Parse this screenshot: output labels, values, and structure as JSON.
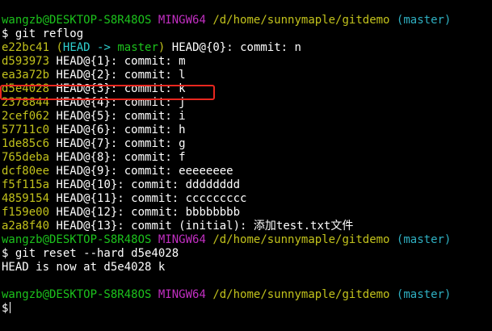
{
  "prompt": {
    "user_host": "wangzb@DESKTOP-S8R48OS",
    "system": "MINGW64",
    "path": "/d/home/sunnymaple/gitdemo",
    "branch": "(master)"
  },
  "commands": {
    "reflog": "$ git reflog",
    "reset": "$ git reset --hard d5e4028",
    "final_prompt": "$"
  },
  "reflog_first": {
    "hash": "e22bc41",
    "paren_open": "(",
    "head": "HEAD ->",
    "branch": "master",
    "paren_close": ")",
    "text": "HEAD@{0}: commit: n"
  },
  "reflog_entries": [
    {
      "hash": "d593973",
      "text": "HEAD@{1}: commit: m"
    },
    {
      "hash": "ea3a72b",
      "text": "HEAD@{2}: commit: l"
    },
    {
      "hash": "d5e4028",
      "text": "HEAD@{3}: commit: k"
    },
    {
      "hash": "2378844",
      "text": "HEAD@{4}: commit: j"
    },
    {
      "hash": "2cef062",
      "text": "HEAD@{5}: commit: i"
    },
    {
      "hash": "57711c0",
      "text": "HEAD@{6}: commit: h"
    },
    {
      "hash": "1de85c6",
      "text": "HEAD@{7}: commit: g"
    },
    {
      "hash": "765deba",
      "text": "HEAD@{8}: commit: f"
    },
    {
      "hash": "dcf80ee",
      "text": "HEAD@{9}: commit: eeeeeeee"
    },
    {
      "hash": "f5f115a",
      "text": "HEAD@{10}: commit: dddddddd"
    },
    {
      "hash": "4859154",
      "text": "HEAD@{11}: commit: ccccccccc"
    },
    {
      "hash": "f159e00",
      "text": "HEAD@{12}: commit: bbbbbbbb"
    },
    {
      "hash": "a2a8f40",
      "text": "HEAD@{13}: commit (initial): 添加test.txt文件"
    }
  ],
  "reset_output": "HEAD is now at d5e4028 k",
  "colors": {
    "user_host": "#1cc21c",
    "system": "#c22fc2",
    "path": "#c2c21c",
    "branch": "#2fb0c2",
    "hash": "#c2c21c",
    "highlight_box": "#e8271f"
  }
}
